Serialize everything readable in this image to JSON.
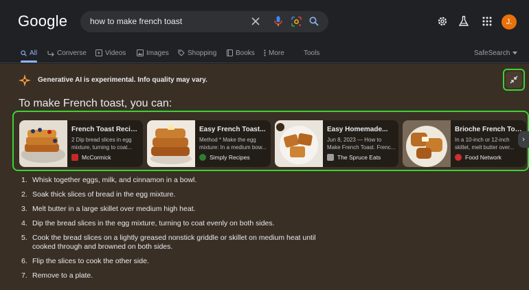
{
  "header": {
    "logo": "Google",
    "search_query": "how to make french toast",
    "avatar_letter": "J."
  },
  "tabs": [
    {
      "label": "All",
      "icon": "search-icon",
      "active": true
    },
    {
      "label": "Converse",
      "icon": "converse-icon"
    },
    {
      "label": "Videos",
      "icon": "video-icon"
    },
    {
      "label": "Images",
      "icon": "image-icon"
    },
    {
      "label": "Shopping",
      "icon": "tag-icon"
    },
    {
      "label": "Books",
      "icon": "book-icon"
    },
    {
      "label": "More",
      "icon": "more-icon"
    },
    {
      "label": "Tools"
    },
    {
      "label": "SafeSearch"
    }
  ],
  "ai": {
    "notice": "Generative AI is experimental. Info quality may vary.",
    "heading": "To make French toast, you can:",
    "cards": [
      {
        "title": "French Toast Recipe:...",
        "snippet": [
          "2 Dip bread slices in egg",
          "mixture, turning to coat..."
        ],
        "source": "McCormick",
        "fav_color": "#c62828"
      },
      {
        "title": "Easy French Toast...",
        "snippet": [
          "Method * Make the egg",
          "mixture: In a medium bow..."
        ],
        "source": "Simply Recipes",
        "fav_color": "#2e7d32"
      },
      {
        "title": "Easy Homemade...",
        "snippet": [
          "Jun 8, 2023 — How to",
          "Make French Toast. Frenc..."
        ],
        "source": "The Spruce Eats",
        "fav_color": "#9e9e9e"
      },
      {
        "title": "Brioche French Toast...",
        "snippet": [
          "In a 10-inch or 12-inch",
          "skillet, melt butter over..."
        ],
        "source": "Food Network",
        "fav_color": "#d32f2f"
      }
    ],
    "steps": [
      {
        "num": "1.",
        "text": "Whisk together eggs, milk, and cinnamon in a bowl."
      },
      {
        "num": "2.",
        "text": "Soak thick slices of bread in the egg mixture."
      },
      {
        "num": "3.",
        "text": "Melt butter in a large skillet over medium high heat."
      },
      {
        "num": "4.",
        "text": "Dip the bread slices in the egg mixture, turning to coat evenly on both sides."
      },
      {
        "num": "5.",
        "text": "Cook the bread slices on a lightly greased nonstick griddle or skillet on medium heat until cooked through and browned on both sides."
      },
      {
        "num": "6.",
        "text": "Flip the slices to cook the other side."
      },
      {
        "num": "7.",
        "text": "Remove to a plate."
      }
    ]
  },
  "colors": {
    "accent_blue": "#8ab4f8",
    "highlight_green": "#3bd435",
    "ai_panel_bg": "#3a2f25"
  }
}
